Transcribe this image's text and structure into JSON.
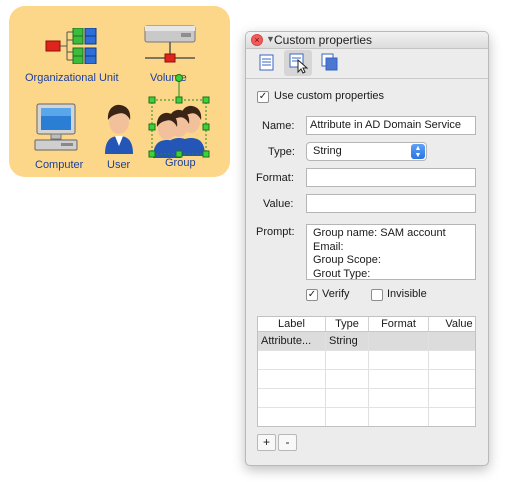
{
  "stencil": {
    "items": [
      {
        "label": "Organizational Unit"
      },
      {
        "label": "Volume"
      },
      {
        "label": "Computer"
      },
      {
        "label": "User"
      },
      {
        "label": "Group"
      }
    ]
  },
  "panel": {
    "title": "Custom properties",
    "tabs": [
      {
        "icon": "document-icon"
      },
      {
        "icon": "cursor-select-icon"
      },
      {
        "icon": "copy-icon"
      }
    ],
    "use_custom": {
      "label": "Use custom properties",
      "checked": true
    },
    "name": {
      "label": "Name:",
      "value": "Attribute in AD Domain Service"
    },
    "type": {
      "label": "Type:",
      "value": "String"
    },
    "format": {
      "label": "Format:",
      "value": ""
    },
    "value": {
      "label": "Value:",
      "value": ""
    },
    "prompt": {
      "label": "Prompt:",
      "value": "Group name: SAM account\nEmail:\nGroup Scope:\nGrout Type:"
    },
    "verify": {
      "label": "Verify",
      "checked": true
    },
    "invisible": {
      "label": "Invisible",
      "checked": false
    },
    "table": {
      "headers": [
        "Label",
        "Type",
        "Format",
        "Value"
      ],
      "rows": [
        [
          "Attribute...",
          "String",
          "",
          ""
        ],
        [
          "",
          "",
          "",
          ""
        ],
        [
          "",
          "",
          "",
          ""
        ],
        [
          "",
          "",
          "",
          ""
        ],
        [
          "",
          "",
          "",
          ""
        ]
      ]
    },
    "add_label": "+",
    "remove_label": "-"
  }
}
